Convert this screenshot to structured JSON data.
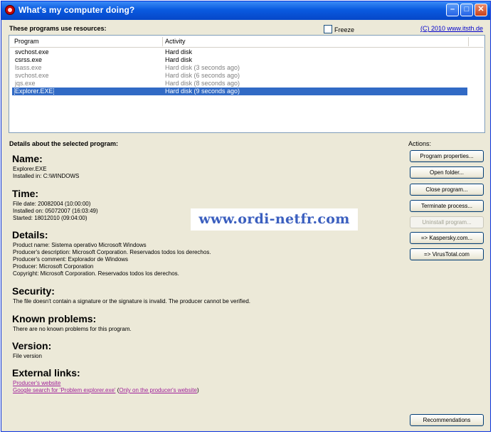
{
  "window": {
    "title": "What's my computer doing?"
  },
  "resources": {
    "label": "These programs use resources:",
    "freeze_label": "Freeze",
    "copyright": "(C) 2010 www.itsth.de",
    "columns": {
      "program": "Program",
      "activity": "Activity"
    },
    "rows": [
      {
        "program": "svchost.exe",
        "activity": "Hard disk"
      },
      {
        "program": "csrss.exe",
        "activity": "Hard disk"
      },
      {
        "program": "lsass.exe",
        "activity": "Hard disk (3 seconds ago)"
      },
      {
        "program": "svchost.exe",
        "activity": "Hard disk (6 seconds ago)"
      },
      {
        "program": "jqs.exe",
        "activity": "Hard disk (8 seconds ago)"
      },
      {
        "program": "Explorer.EXE",
        "activity": "Hard disk (9 seconds ago)"
      }
    ]
  },
  "details": {
    "label": "Details about the selected program:",
    "name": {
      "heading": "Name:",
      "line1": "Explorer.EXE",
      "line2": "Installed in: C:\\WINDOWS"
    },
    "time": {
      "heading": "Time:",
      "line1": "File date: 20082004 (10:00:00)",
      "line2": "Installed on: 05072007 (16:03:49)",
      "line3": "Started: 18012010 (09:04:00)"
    },
    "info": {
      "heading": "Details:",
      "line1": "Product name: Sistema operativo Microsoft Windows",
      "line2": "Producer's description: Microsoft Corporation. Reservados todos los derechos.",
      "line3": "Producer's comment: Explorador de Windows",
      "line4": "Producer: Microsoft Corporation",
      "line5": "Copyright: Microsoft Corporation. Reservados todos los derechos."
    },
    "security": {
      "heading": "Security:",
      "text": "The file doesn't contain a signature or the signature is invalid. The producer cannot be verified."
    },
    "known": {
      "heading": "Known problems:",
      "text": "There are no known problems for this program."
    },
    "version": {
      "heading": "Version:",
      "text": "File version"
    },
    "links": {
      "heading": "External links:",
      "producer": "Producer's website",
      "google": "Google search for 'Problem explorer.exe'",
      "open_paren": " (",
      "only_producer": "Only on the producer's website",
      "close_paren": ")"
    }
  },
  "actions": {
    "label": "Actions:",
    "program_properties": "Program properties...",
    "open_folder": "Open folder...",
    "close_program": "Close program...",
    "terminate_process": "Terminate process...",
    "uninstall_program": "Uninstall program...",
    "kaspersky": "=> Kaspersky.com...",
    "virustotal": "=> VirusTotal.com",
    "recommendations": "Recommendations"
  },
  "watermark": "www.ordi-netfr.com"
}
